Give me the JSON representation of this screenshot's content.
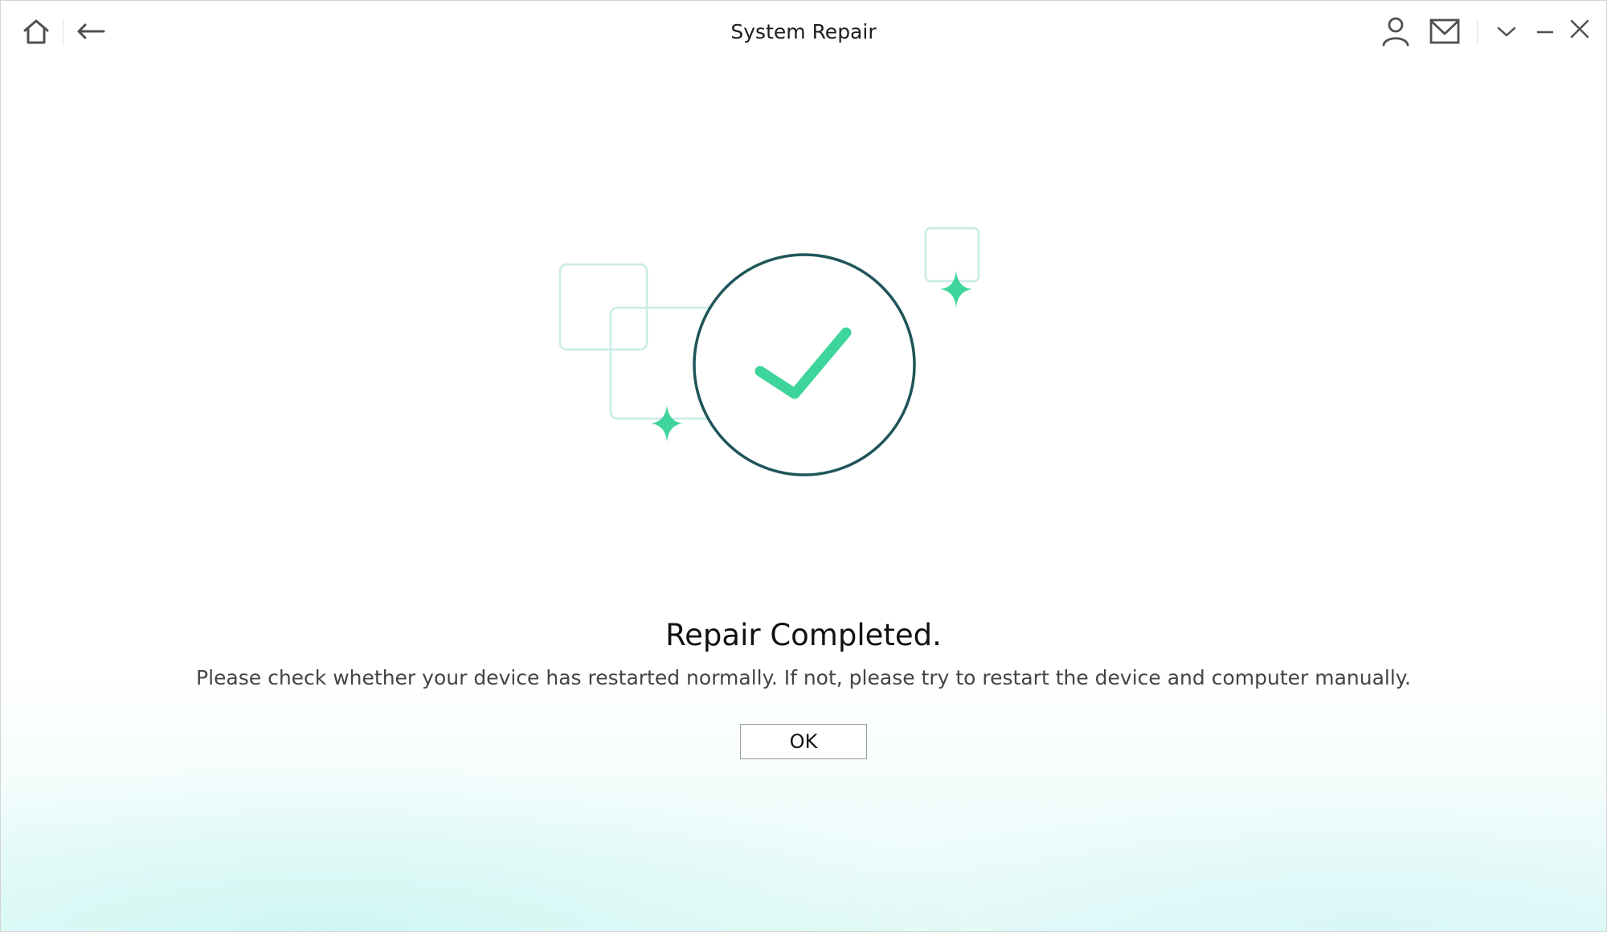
{
  "window": {
    "title": "System Repair"
  },
  "titlebar": {
    "left_icons": [
      "home-icon",
      "back-arrow-icon"
    ],
    "right_icons": [
      "user-icon",
      "mail-icon",
      "chevron-down-icon",
      "minimize-icon",
      "close-icon"
    ]
  },
  "result": {
    "heading": "Repair Completed.",
    "message": "Please check whether your device has restarted normally. If not, please try to restart the device and computer manually.",
    "ok_label": "OK"
  },
  "colors": {
    "accent_green": "#3dd59b",
    "circle_stroke": "#1f5559",
    "deco_square": "#c9ebe6"
  }
}
